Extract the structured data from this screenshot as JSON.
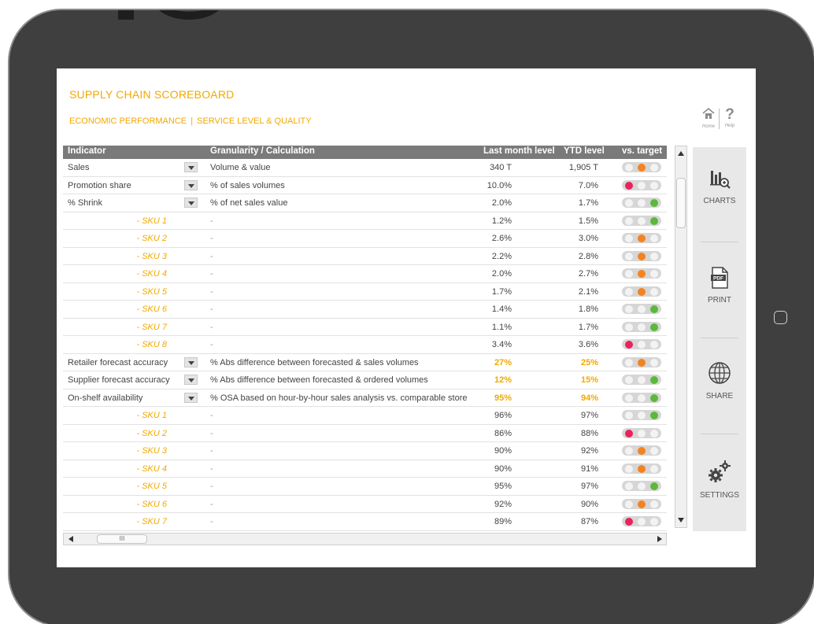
{
  "page": {
    "title": "SUPPLY CHAIN SCOREBOARD",
    "subtitle_left": "ECONOMIC PERFORMANCE",
    "subtitle_sep": "|",
    "subtitle_right": "SERVICE LEVEL & QUALITY"
  },
  "topnav": {
    "home_label": "Home",
    "help_label": "Help",
    "help_glyph": "?"
  },
  "table": {
    "headers": {
      "indicator": "Indicator",
      "granularity": "Granularity / Calculation",
      "last_month": "Last month level",
      "ytd": "YTD level",
      "target": "vs. target"
    },
    "rows": [
      {
        "indicator": "Sales",
        "sku": "",
        "granularity": "Volume & value",
        "last_month": "340 T",
        "ytd": "1,905 T",
        "light": "orange",
        "dropdown": true,
        "highlight": false
      },
      {
        "indicator": "Promotion share",
        "sku": "",
        "granularity": "% of sales volumes",
        "last_month": "10.0%",
        "ytd": "7.0%",
        "light": "red",
        "dropdown": true,
        "highlight": false
      },
      {
        "indicator": "% Shrink",
        "sku": "",
        "granularity": "% of net sales value",
        "last_month": "2.0%",
        "ytd": "1.7%",
        "light": "green",
        "dropdown": true,
        "highlight": false
      },
      {
        "indicator": "",
        "sku": "- SKU 1",
        "granularity": "-",
        "last_month": "1.2%",
        "ytd": "1.5%",
        "light": "green",
        "dropdown": false,
        "highlight": false
      },
      {
        "indicator": "",
        "sku": "- SKU 2",
        "granularity": "-",
        "last_month": "2.6%",
        "ytd": "3.0%",
        "light": "orange",
        "dropdown": false,
        "highlight": false
      },
      {
        "indicator": "",
        "sku": "- SKU 3",
        "granularity": "-",
        "last_month": "2.2%",
        "ytd": "2.8%",
        "light": "orange",
        "dropdown": false,
        "highlight": false
      },
      {
        "indicator": "",
        "sku": "- SKU 4",
        "granularity": "-",
        "last_month": "2.0%",
        "ytd": "2.7%",
        "light": "orange",
        "dropdown": false,
        "highlight": false
      },
      {
        "indicator": "",
        "sku": "- SKU 5",
        "granularity": "-",
        "last_month": "1.7%",
        "ytd": "2.1%",
        "light": "orange",
        "dropdown": false,
        "highlight": false
      },
      {
        "indicator": "",
        "sku": "- SKU 6",
        "granularity": "-",
        "last_month": "1.4%",
        "ytd": "1.8%",
        "light": "green",
        "dropdown": false,
        "highlight": false
      },
      {
        "indicator": "",
        "sku": "- SKU 7",
        "granularity": "-",
        "last_month": "1.1%",
        "ytd": "1.7%",
        "light": "green",
        "dropdown": false,
        "highlight": false
      },
      {
        "indicator": "",
        "sku": "- SKU 8",
        "granularity": "-",
        "last_month": "3.4%",
        "ytd": "3.6%",
        "light": "red",
        "dropdown": false,
        "highlight": false
      },
      {
        "indicator": "Retailer forecast accuracy",
        "sku": "",
        "granularity": "% Abs difference between forecasted & sales volumes",
        "last_month": "27%",
        "ytd": "25%",
        "light": "orange",
        "dropdown": true,
        "highlight": true
      },
      {
        "indicator": "Supplier forecast accuracy",
        "sku": "",
        "granularity": "% Abs difference between forecasted & ordered volumes",
        "last_month": "12%",
        "ytd": "15%",
        "light": "green",
        "dropdown": true,
        "highlight": true
      },
      {
        "indicator": "On-shelf availability",
        "sku": "",
        "granularity": "% OSA based on hour-by-hour sales analysis vs. comparable store",
        "last_month": "95%",
        "ytd": "94%",
        "light": "green",
        "dropdown": true,
        "highlight": true
      },
      {
        "indicator": "",
        "sku": "- SKU 1",
        "granularity": "-",
        "last_month": "96%",
        "ytd": "97%",
        "light": "green",
        "dropdown": false,
        "highlight": false
      },
      {
        "indicator": "",
        "sku": "- SKU 2",
        "granularity": "-",
        "last_month": "86%",
        "ytd": "88%",
        "light": "red",
        "dropdown": false,
        "highlight": false
      },
      {
        "indicator": "",
        "sku": "- SKU 3",
        "granularity": "-",
        "last_month": "90%",
        "ytd": "92%",
        "light": "orange",
        "dropdown": false,
        "highlight": false
      },
      {
        "indicator": "",
        "sku": "- SKU 4",
        "granularity": "-",
        "last_month": "90%",
        "ytd": "91%",
        "light": "orange",
        "dropdown": false,
        "highlight": false
      },
      {
        "indicator": "",
        "sku": "- SKU 5",
        "granularity": "-",
        "last_month": "95%",
        "ytd": "97%",
        "light": "green",
        "dropdown": false,
        "highlight": false
      },
      {
        "indicator": "",
        "sku": "- SKU 6",
        "granularity": "-",
        "last_month": "92%",
        "ytd": "90%",
        "light": "orange",
        "dropdown": false,
        "highlight": false
      },
      {
        "indicator": "",
        "sku": "- SKU 7",
        "granularity": "-",
        "last_month": "89%",
        "ytd": "87%",
        "light": "red",
        "dropdown": false,
        "highlight": false
      }
    ]
  },
  "hscroll": {
    "thumb_glyph": "III"
  },
  "panel": {
    "items": [
      {
        "label": "CHARTS",
        "icon": "bar-chart-zoom-icon"
      },
      {
        "label": "PRINT",
        "icon": "pdf-icon"
      },
      {
        "label": "SHARE",
        "icon": "globe-icon"
      },
      {
        "label": "SETTINGS",
        "icon": "gears-icon"
      }
    ]
  },
  "colors": {
    "accent": "#f2a900",
    "red": "#e8225a",
    "orange": "#f58220",
    "green": "#5cb83a",
    "header_bg": "#7a7a7a",
    "bezel": "#3f3f3f"
  }
}
